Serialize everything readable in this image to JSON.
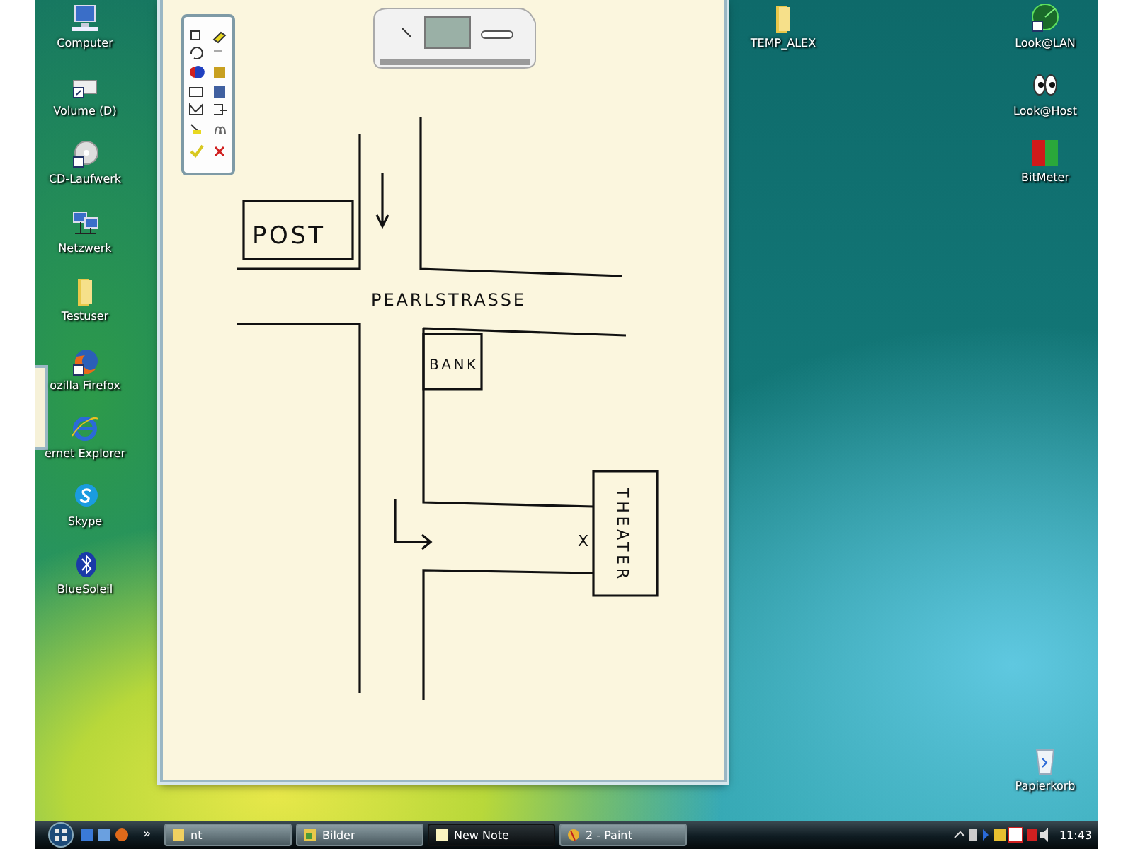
{
  "desktop_icons_left": [
    {
      "label": "Computer",
      "kind": "computer"
    },
    {
      "label": "Volume (D)",
      "kind": "drive"
    },
    {
      "label": "CD-Laufwerk",
      "kind": "cd"
    },
    {
      "label": "Netzwerk",
      "kind": "network"
    },
    {
      "label": "Testuser",
      "kind": "folder"
    },
    {
      "label": "ozilla Firefox",
      "kind": "firefox"
    },
    {
      "label": "ernet Explorer",
      "kind": "ie"
    },
    {
      "label": "Skype",
      "kind": "skype"
    },
    {
      "label": "BlueSoleil",
      "kind": "bluetooth"
    }
  ],
  "desktop_icons_right": [
    {
      "label": "TEMP_ALEX",
      "kind": "folder"
    },
    {
      "label": "Look@LAN",
      "kind": "lan"
    },
    {
      "label": "Look@Host",
      "kind": "host"
    },
    {
      "label": "BitMeter",
      "kind": "meter"
    },
    {
      "label": "Papierkorb",
      "kind": "recycle"
    }
  ],
  "note": {
    "map_labels": [
      {
        "text": "POST",
        "kind": "post"
      },
      {
        "text": "PEARLSTRASSE",
        "kind": "street"
      },
      {
        "text": "BANK",
        "kind": "bank"
      },
      {
        "text": "THEATER",
        "kind": "theater"
      },
      {
        "text": "X",
        "kind": "mark"
      }
    ]
  },
  "taskbar": {
    "overflow": "»",
    "tasks": [
      {
        "label": "nt",
        "kind": "folder",
        "selected": false
      },
      {
        "label": "Bilder",
        "kind": "pictures",
        "selected": false
      },
      {
        "label": "New Note",
        "kind": "note",
        "selected": true
      },
      {
        "label": "2 - Paint",
        "kind": "paint",
        "selected": false
      }
    ],
    "clock": "11:43"
  }
}
